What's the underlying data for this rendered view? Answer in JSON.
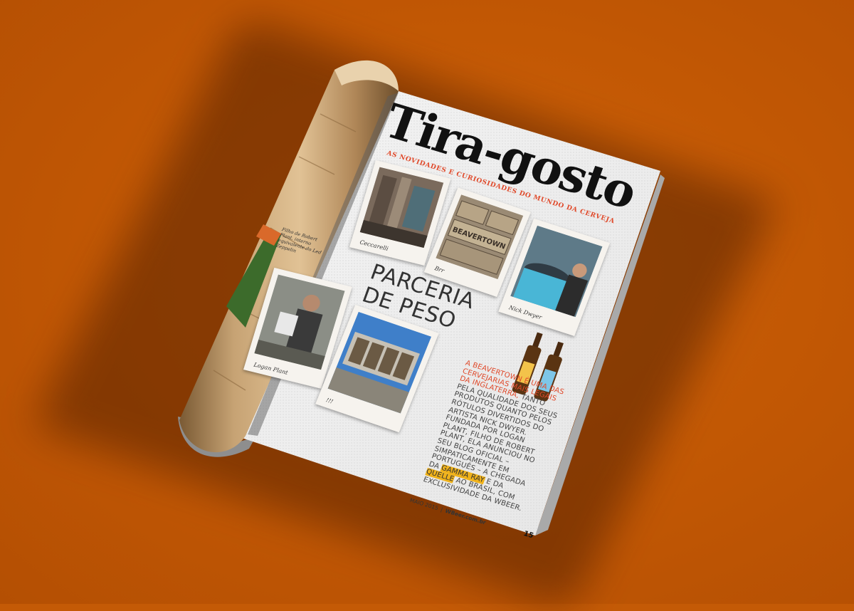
{
  "magazine": {
    "title": "Tira-gosto",
    "subtitle": "AS NOVIDADES E CURIOSIDADES DO MUNDO DA CERVEJA",
    "headline_line1": "PARCERIA",
    "headline_line2": "DE PESO",
    "photo_signatures": [
      "Ceccarelli",
      "Brr",
      "Nick Dwyer",
      "Logan Plant",
      "!!!"
    ],
    "caption": "Filho de Robert Plant, interno equivalente do Led Zeppelin",
    "body_lead": "A BEAVERTOWN É UMA DAS CERVEJARIAS MAIS LEGAIS DA INGLATERRA,",
    "body_main": " TANTO PELA QUALIDADE DOS SEUS PRODUTOS QUANTO PELOS RÓTULOS DIVERTIDOS DO ARTISTA NICK DWYER. FUNDADA POR LOGAN PLANT, FILHO DE ROBERT PLANT, ELA ANUNCIOU NO SEU BLOG OFICIAL – SIMPATICAMENTE EM PORTUGUÊS – A CHEGADA DA ",
    "highlight1": "GAMMA RAY",
    "body_mid": " E DA ",
    "highlight2": "QUELLE",
    "body_end": " AO BRASIL, COM EXCLUSIVIDADE DA WBEER.",
    "footer_date": "MAIO 2015",
    "footer_site": "WBeer.com.br",
    "page_number": "15",
    "crate_text": "BEAVERTOWN"
  },
  "colors": {
    "background": "#c45a06",
    "accent_red": "#e04a2b",
    "highlight": "#f0b21a"
  }
}
